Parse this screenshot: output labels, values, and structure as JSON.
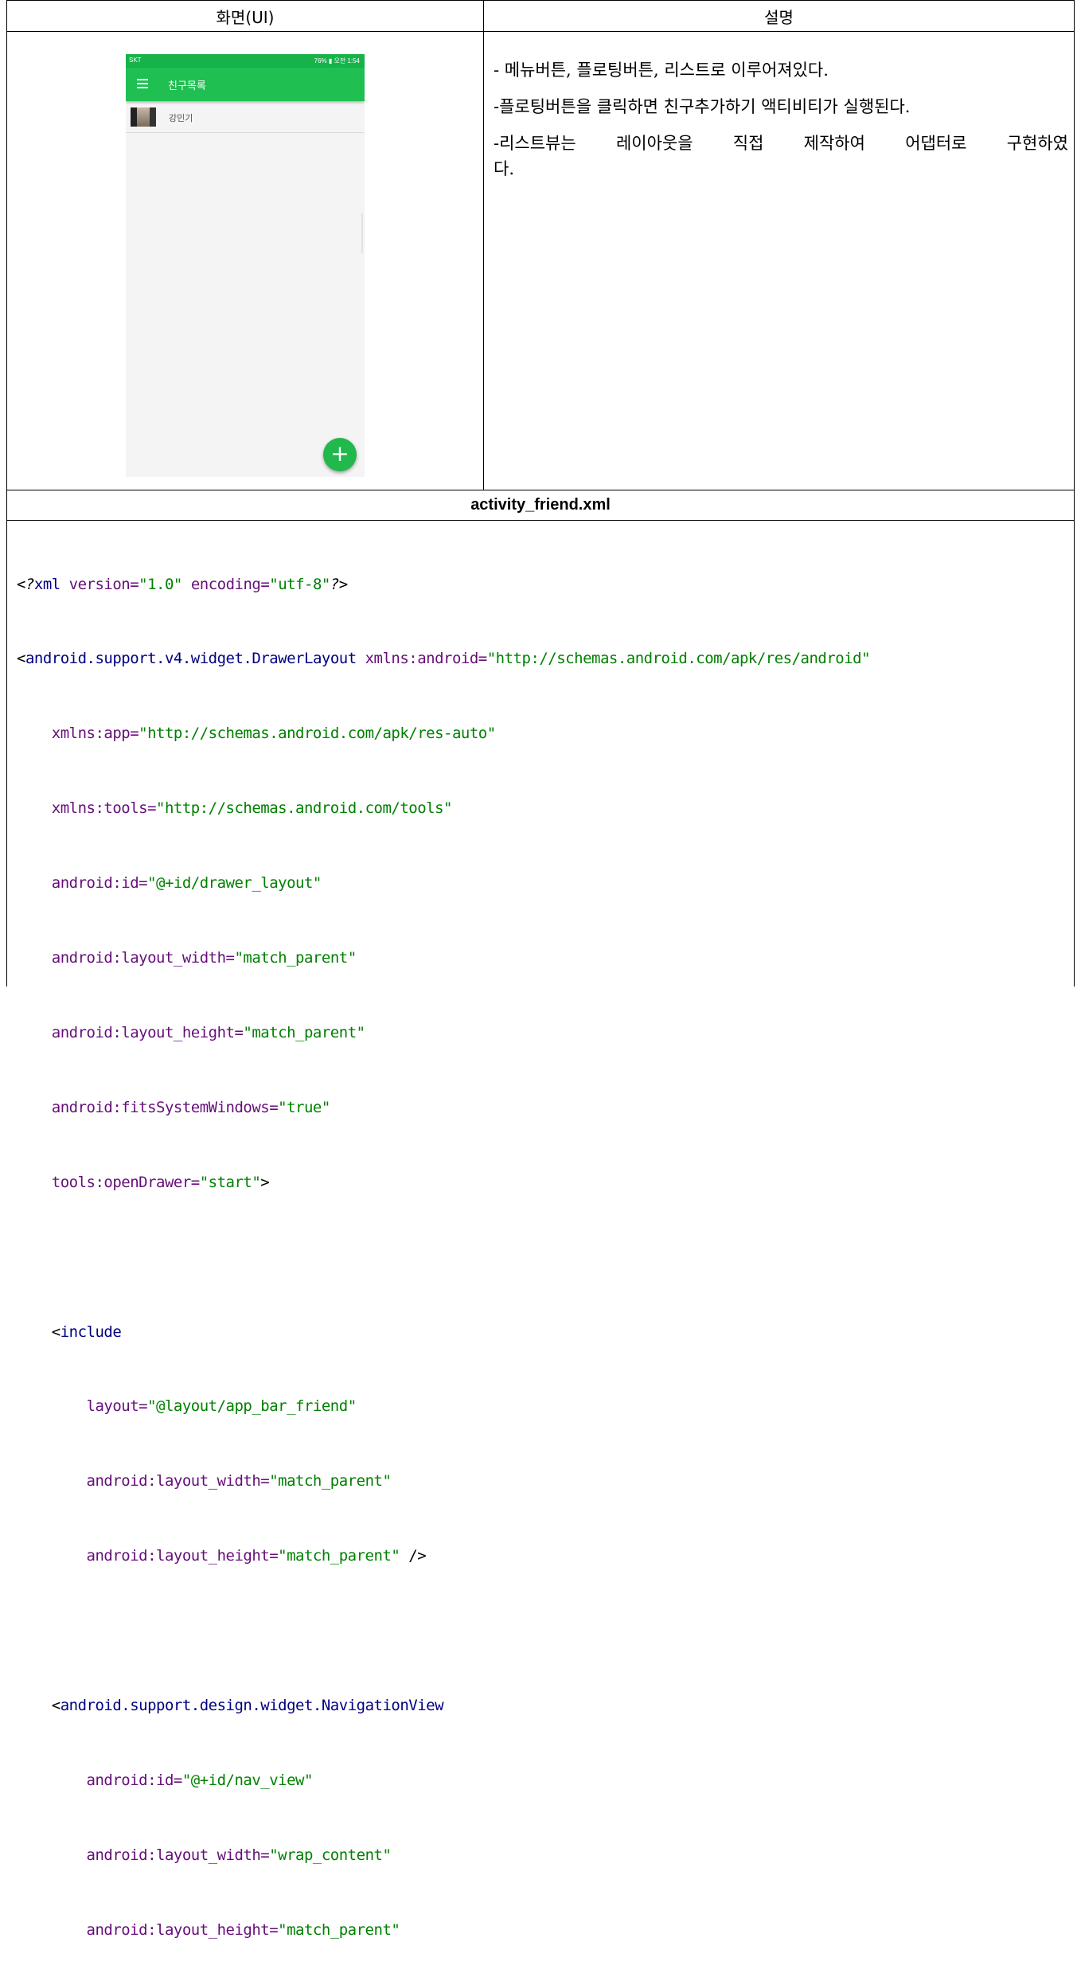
{
  "table": {
    "header_ui": "화면(UI)",
    "header_desc": "설명",
    "file_title": "activity_friend.xml"
  },
  "phone": {
    "status_left": "SKT",
    "status_right": "76% ▮ 오전 1:54",
    "app_title": "친구목록",
    "list": [
      {
        "name": "강민기"
      }
    ],
    "fab_icon": "plus-icon",
    "colors": {
      "appbar": "#1fbf52",
      "status": "#17b34a",
      "fab": "#21b84c"
    }
  },
  "description": {
    "line1": "- 메뉴버튼, 플로팅버튼, 리스트로 이루어져있다.",
    "line2": "-플로팅버튼을 클릭하면 친구추가하기 액티비티가 실행된다.",
    "line3a": "-리스트뷰는 레이아웃을 직접 제작하여 어댑터로 구현하였",
    "line3b": "다."
  },
  "code": {
    "l1_pi_open": "<?",
    "l1_xml": "xml",
    "l1_version_attr": " version=",
    "l1_version_val": "\"1.0\"",
    "l1_encoding_attr": " encoding=",
    "l1_encoding_val": "\"utf-8\"",
    "l1_pi_close": "?>",
    "l2_open": "<",
    "l2_tag": "android.support.v4.widget.DrawerLayout",
    "l2_attr": " xmlns:android=",
    "l2_val": "\"http://schemas.android.com/apk/res/android\"",
    "l3_attr": "    xmlns:app=",
    "l3_val": "\"http://schemas.android.com/apk/res-auto\"",
    "l4_attr": "    xmlns:tools=",
    "l4_val": "\"http://schemas.android.com/tools\"",
    "l5_attr": "    android:id=",
    "l5_val": "\"@+id/drawer_layout\"",
    "l6_attr": "    android:layout_width=",
    "l6_val": "\"match_parent\"",
    "l7_attr": "    android:layout_height=",
    "l7_val": "\"match_parent\"",
    "l8_attr": "    android:fitsSystemWindows=",
    "l8_val": "\"true\"",
    "l9_attr": "    tools:openDrawer=",
    "l9_val": "\"start\"",
    "l9_close": ">",
    "l11_open": "    <",
    "l11_tag": "include",
    "l12_attr": "        layout=",
    "l12_val": "\"@layout/app_bar_friend\"",
    "l13_attr": "        android:layout_width=",
    "l13_val": "\"match_parent\"",
    "l14_attr": "        android:layout_height=",
    "l14_val": "\"match_parent\"",
    "l14_close": " />",
    "l16_open": "    <",
    "l16_tag": "android.support.design.widget.NavigationView",
    "l17_attr": "        android:id=",
    "l17_val": "\"@+id/nav_view\"",
    "l18_attr": "        android:layout_width=",
    "l18_val": "\"wrap_content\"",
    "l19_attr": "        android:layout_height=",
    "l19_val": "\"match_parent\""
  }
}
